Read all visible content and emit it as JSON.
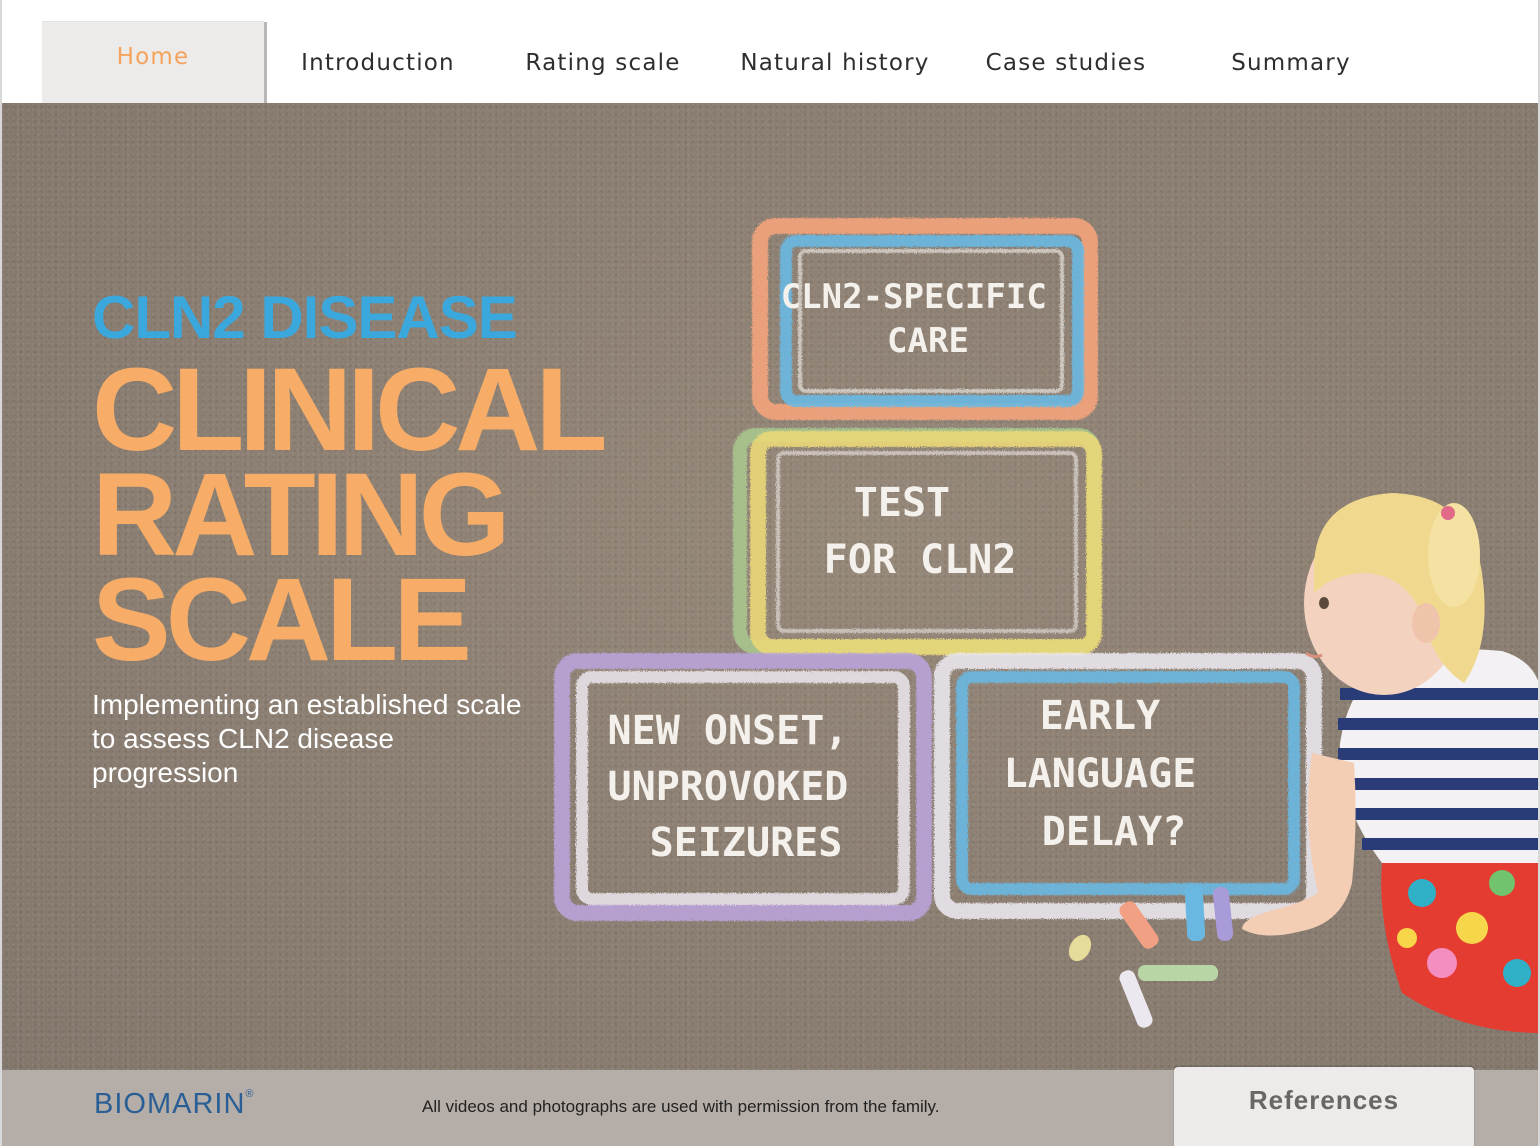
{
  "nav": {
    "tabs": [
      {
        "label": "Home",
        "active": true
      },
      {
        "label": "Introduction",
        "active": false
      },
      {
        "label": "Rating scale",
        "active": false
      },
      {
        "label": "Natural history",
        "active": false
      },
      {
        "label": "Case studies",
        "active": false
      },
      {
        "label": "Summary",
        "active": false
      }
    ]
  },
  "hero": {
    "eyebrow": "CLN2 DISEASE",
    "title_lines": [
      "CLINICAL",
      "RATING",
      "SCALE"
    ],
    "tagline": "Implementing an established scale to assess CLN2 disease progression",
    "chalk_boxes": [
      {
        "lines": [
          "CLN2-SPECIFIC",
          "CARE"
        ],
        "outer": "#f4a47c",
        "inner": "#6ab8e2"
      },
      {
        "lines": [
          "TEST",
          "FOR CLN2"
        ],
        "outer": "#e8d67a",
        "inner": "#a9c98e"
      },
      {
        "lines": [
          "NEW ONSET,",
          "UNPROVOKED",
          "SEIZURES"
        ],
        "outer": "#b9a3d8",
        "inner": "#ece8ef"
      },
      {
        "lines": [
          "EARLY",
          "LANGUAGE",
          "DELAY?"
        ],
        "outer": "#ece8ef",
        "inner": "#6ab8e2"
      }
    ]
  },
  "footer": {
    "logo": "BIOMARIN",
    "logo_mark": "®",
    "permission": "All videos and photographs are used with permission from the family.",
    "references_label": "References"
  },
  "colors": {
    "accent_orange": "#f7ad67",
    "accent_blue": "#3aa8dd",
    "logo_blue": "#2a5f95",
    "asphalt": "#8f8276"
  }
}
